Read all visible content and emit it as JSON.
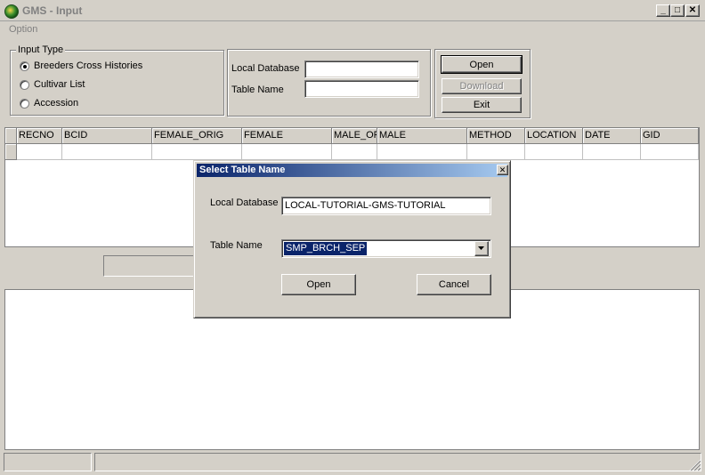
{
  "window": {
    "title": "GMS - Input",
    "minimize_glyph": "_",
    "maximize_glyph": "□",
    "close_glyph": "✕"
  },
  "menu": {
    "option": "Option"
  },
  "input_type": {
    "label": "Input Type",
    "options": [
      {
        "label": "Breeders Cross Histories",
        "selected": true
      },
      {
        "label": "Cultivar List",
        "selected": false
      },
      {
        "label": "Accession",
        "selected": false
      }
    ]
  },
  "database": {
    "local_database_label": "Local Database",
    "local_database_value": "",
    "table_name_label": "Table Name",
    "table_name_value": ""
  },
  "buttons": {
    "open": "Open",
    "download": "Download",
    "exit": "Exit"
  },
  "grid": {
    "columns": [
      "RECNO",
      "BCID",
      "FEMALE_ORIG",
      "FEMALE",
      "MALE_ORIG",
      "MALE",
      "METHOD",
      "LOCATION",
      "DATE",
      "GID"
    ]
  },
  "dialog": {
    "title": "Select Table Name",
    "close_glyph": "✕",
    "local_database_label": "Local Database",
    "local_database_value": "LOCAL-TUTORIAL-GMS-TUTORIAL",
    "table_name_label": "Table Name",
    "table_name_value": "SMP_BRCH_SEP",
    "open_button": "Open",
    "cancel_button": "Cancel"
  }
}
